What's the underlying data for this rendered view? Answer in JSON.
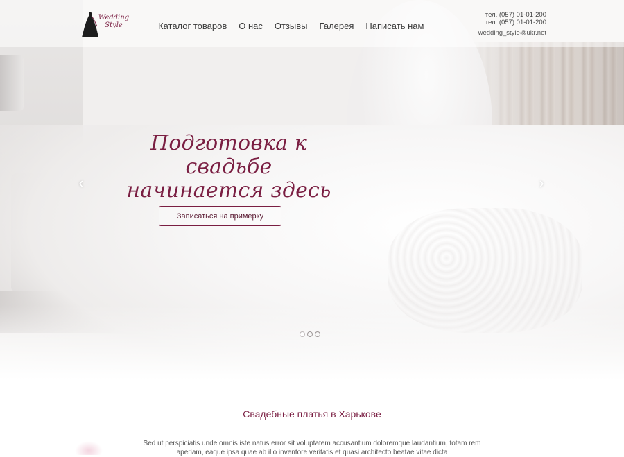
{
  "brand": {
    "logo_line1": "Wedding",
    "logo_line2": "Style",
    "accent_color": "#7a1e42"
  },
  "nav": {
    "items": [
      "Каталог товаров",
      "О нас",
      "Отзывы",
      "Галерея",
      "Написать нам"
    ]
  },
  "contacts": {
    "phone1": "тел. (057) 01-01-200",
    "phone2": "тел. (057) 01-01-200",
    "email": "wedding_style@ukr.net"
  },
  "hero": {
    "title_line1": "Подготовка к свадьбе",
    "title_line2": "начинается здесь",
    "cta_label": "Записаться на примерку",
    "prev_icon": "chevron-left-icon",
    "next_icon": "chevron-right-icon",
    "prev_glyph": "‹",
    "next_glyph": "›",
    "slides_total": 3,
    "slide_active": 1
  },
  "section": {
    "title": "Свадебные платья в Харькове",
    "text": "Sed ut perspiciatis unde omnis iste natus error sit voluptatem accusantium doloremque laudantium, totam rem aperiam, eaque ipsa quae ab illo inventore veritatis et quasi architecto beatae vitae dicta"
  }
}
